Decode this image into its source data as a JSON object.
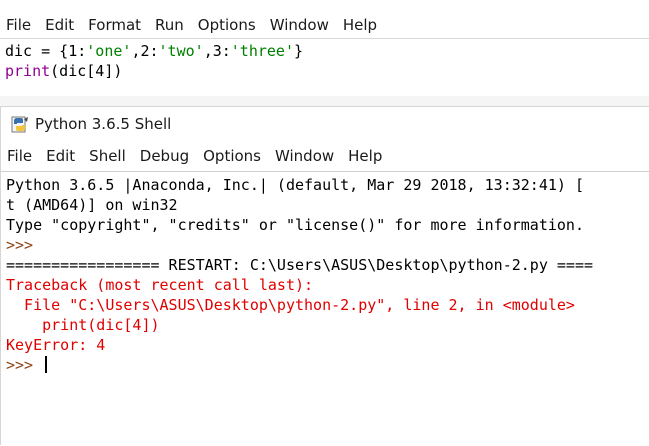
{
  "editor": {
    "menu": [
      "File",
      "Edit",
      "Format",
      "Run",
      "Options",
      "Window",
      "Help"
    ],
    "lines": [
      [
        {
          "t": "dic = {1:",
          "c": "black"
        },
        {
          "t": "'one'",
          "c": "green"
        },
        {
          "t": ",2:",
          "c": "black"
        },
        {
          "t": "'two'",
          "c": "green"
        },
        {
          "t": ",3:",
          "c": "black"
        },
        {
          "t": "'three'",
          "c": "green"
        },
        {
          "t": "}",
          "c": "black"
        }
      ],
      [
        {
          "t": "print",
          "c": "purple"
        },
        {
          "t": "(dic[4])",
          "c": "black"
        }
      ]
    ]
  },
  "shell": {
    "title": "Python 3.6.5 Shell",
    "menu": [
      "File",
      "Edit",
      "Shell",
      "Debug",
      "Options",
      "Window",
      "Help"
    ],
    "lines": [
      [
        {
          "t": "Python 3.6.5 |Anaconda, Inc.| (default, Mar 29 2018, 13:32:41) [",
          "c": "black"
        }
      ],
      [
        {
          "t": "t (AMD64)] on win32",
          "c": "black"
        }
      ],
      [
        {
          "t": "Type \"copyright\", \"credits\" or \"license()\" for more information.",
          "c": "black"
        }
      ],
      [
        {
          "t": ">>> ",
          "c": "brown"
        }
      ],
      [
        {
          "t": "================= RESTART: C:\\Users\\ASUS\\Desktop\\python-2.py ====",
          "c": "black"
        }
      ],
      [
        {
          "t": "Traceback (most recent call last):",
          "c": "red"
        }
      ],
      [
        {
          "t": "  File \"C:\\Users\\ASUS\\Desktop\\python-2.py\", line 2, in <module>",
          "c": "red"
        }
      ],
      [
        {
          "t": "    print(dic[4])",
          "c": "red"
        }
      ],
      [
        {
          "t": "KeyError: 4",
          "c": "red"
        }
      ],
      [
        {
          "t": ">>> ",
          "c": "brown"
        }
      ]
    ]
  }
}
